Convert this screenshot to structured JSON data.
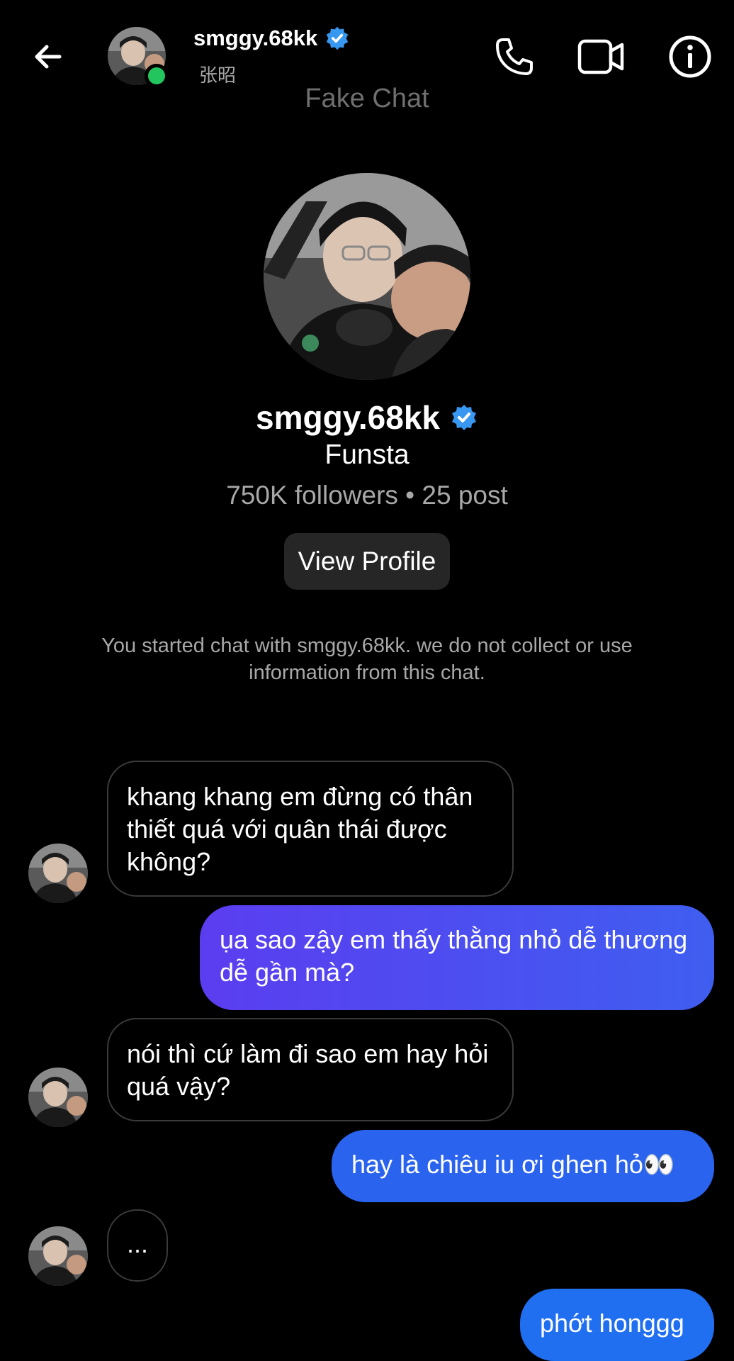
{
  "header": {
    "username": "smggy.68kk",
    "subtitle": "张昭",
    "overlay_label": "Fake Chat",
    "icons": {
      "back": "arrow-left-icon",
      "call": "phone-icon",
      "video": "video-camera-icon",
      "info": "info-circle-icon",
      "verified": "verified-badge-icon"
    }
  },
  "profile": {
    "username": "smggy.68kk",
    "tagline": "Funsta",
    "stats": "750K followers • 25 post",
    "view_profile_label": "View Profile"
  },
  "notice": "You started chat with smggy.68kk. we do not collect or use information from this chat.",
  "messages": [
    {
      "from": "them",
      "text": "khang khang em đừng có thân thiết quá với quân thái được không?"
    },
    {
      "from": "me",
      "text": "ụa sao zậy em thấy thằng nhỏ dễ thương dễ gần mà?"
    },
    {
      "from": "them",
      "text": "nói thì cứ làm đi sao em hay hỏi quá vậy?"
    },
    {
      "from": "me",
      "text": "hay là chiêu iu ơi ghen hỏ👀"
    },
    {
      "from": "them",
      "text": "..."
    },
    {
      "from": "me",
      "text": "phớt honggg"
    }
  ],
  "colors": {
    "background": "#000000",
    "verified": "#3897f0",
    "online": "#22c55e",
    "outgoing_bubble": "#2a63ee",
    "secondary_text": "#a8a8a8"
  }
}
